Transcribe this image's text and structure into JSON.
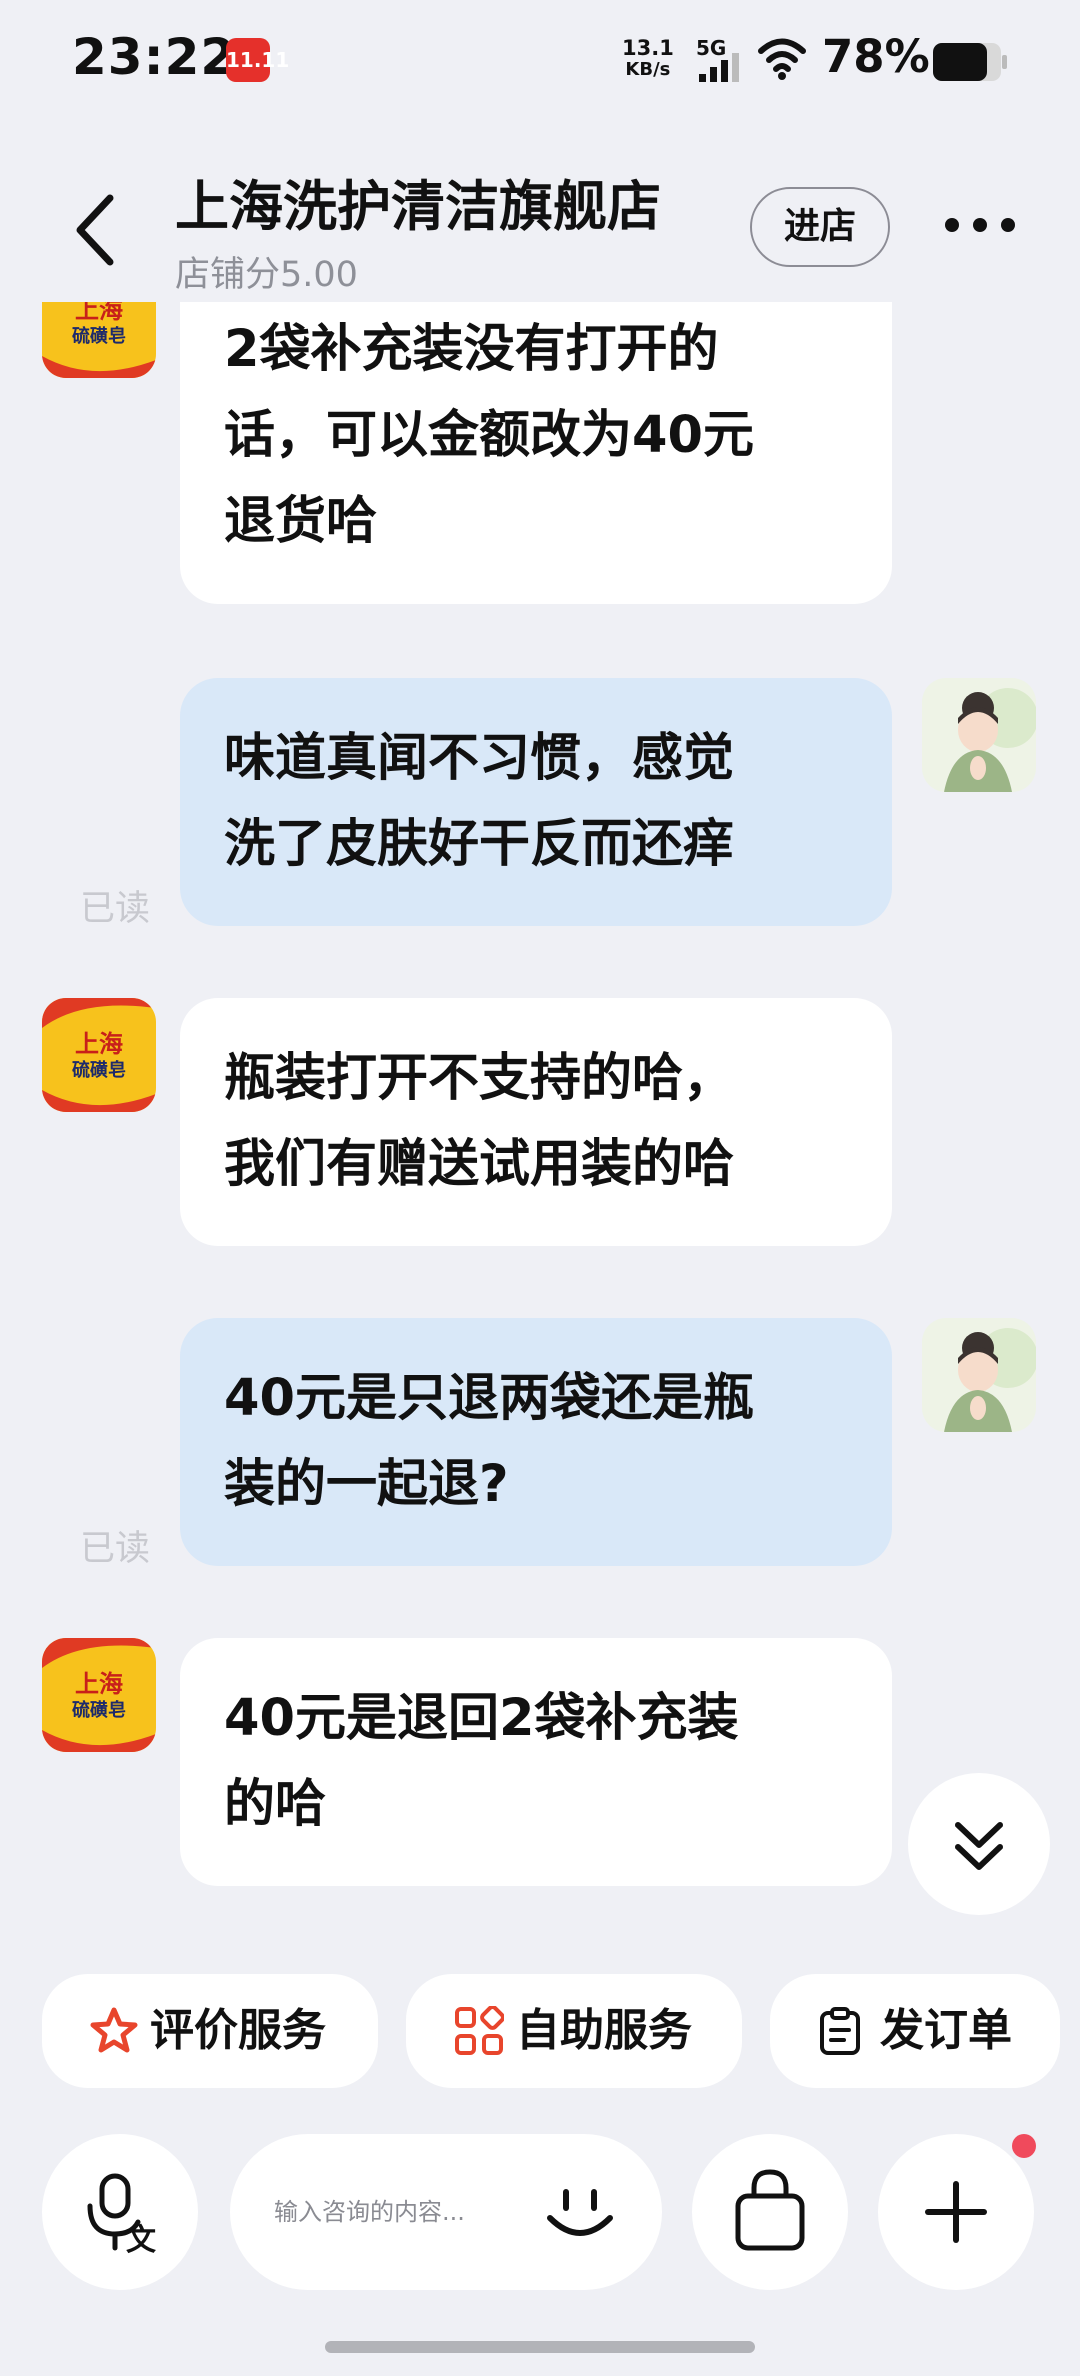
{
  "status_bar": {
    "time": "23:22",
    "app_badge": "11.11",
    "net_speed_value": "13.1",
    "net_speed_unit": "KB/s",
    "net_type": "5G",
    "battery": "78%"
  },
  "header": {
    "shop_name": "上海洗护清洁旗舰店",
    "shop_score": "店铺分5.00",
    "enter_shop_label": "进店"
  },
  "shop_avatar": {
    "line1": "上海",
    "line2": "硫磺皂"
  },
  "messages": [
    {
      "from": "shop",
      "lines": [
        "2袋补充装没有打开的",
        "话，可以金额改为40元",
        "退货哈"
      ]
    },
    {
      "from": "me",
      "lines": [
        "味道真闻不习惯，感觉",
        "洗了皮肤好干反而还痒"
      ],
      "status": "已读"
    },
    {
      "from": "shop",
      "lines": [
        "瓶装打开不支持的哈，",
        "我们有赠送试用装的哈"
      ]
    },
    {
      "from": "me",
      "lines": [
        "40元是只退两袋还是瓶",
        "装的一起退?"
      ],
      "status": "已读"
    },
    {
      "from": "shop",
      "lines": [
        "40元是退回2袋补充装",
        "的哈"
      ]
    }
  ],
  "quick_actions": [
    {
      "label": "评价服务",
      "icon": "star-icon"
    },
    {
      "label": "自助服务",
      "icon": "grid-icon"
    },
    {
      "label": "发订单",
      "icon": "clipboard-icon"
    }
  ],
  "input": {
    "placeholder": "输入咨询的内容..."
  },
  "colors": {
    "page_bg": "#eff0f5",
    "my_bubble": "#d9e8f8",
    "shop_bubble": "#ffffff",
    "accent_red": "#e8452c",
    "notification_dot": "#f04a5c"
  }
}
